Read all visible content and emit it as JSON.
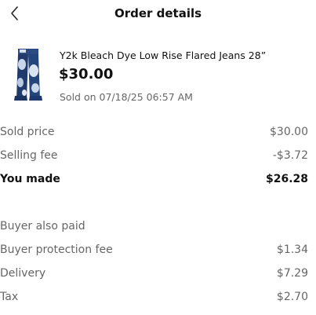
{
  "header": {
    "title": "Order details",
    "back_icon": "chevron-left-icon"
  },
  "product": {
    "name": "Y2k Bleach Dye Low Rise Flared Jeans 28”",
    "price": "$30.00",
    "sold_on": "Sold on 07/18/25 06:57 AM"
  },
  "earnings": {
    "sold_price": {
      "label": "Sold price",
      "value": "$30.00"
    },
    "selling_fee": {
      "label": "Selling fee",
      "value": "-$3.72"
    },
    "you_made": {
      "label": "You made",
      "value": "$26.28"
    }
  },
  "buyer": {
    "heading": "Buyer also paid",
    "protection_fee": {
      "label": "Buyer protection fee",
      "value": "$1.34"
    },
    "delivery": {
      "label": "Delivery",
      "value": "$7.29"
    },
    "tax": {
      "label": "Tax",
      "value": "$2.70"
    }
  },
  "colors": {
    "text_primary": "#111111",
    "text_secondary": "#666666",
    "denim_dark": "#1f3a6b",
    "denim_bleach": "#c9d6ea"
  }
}
